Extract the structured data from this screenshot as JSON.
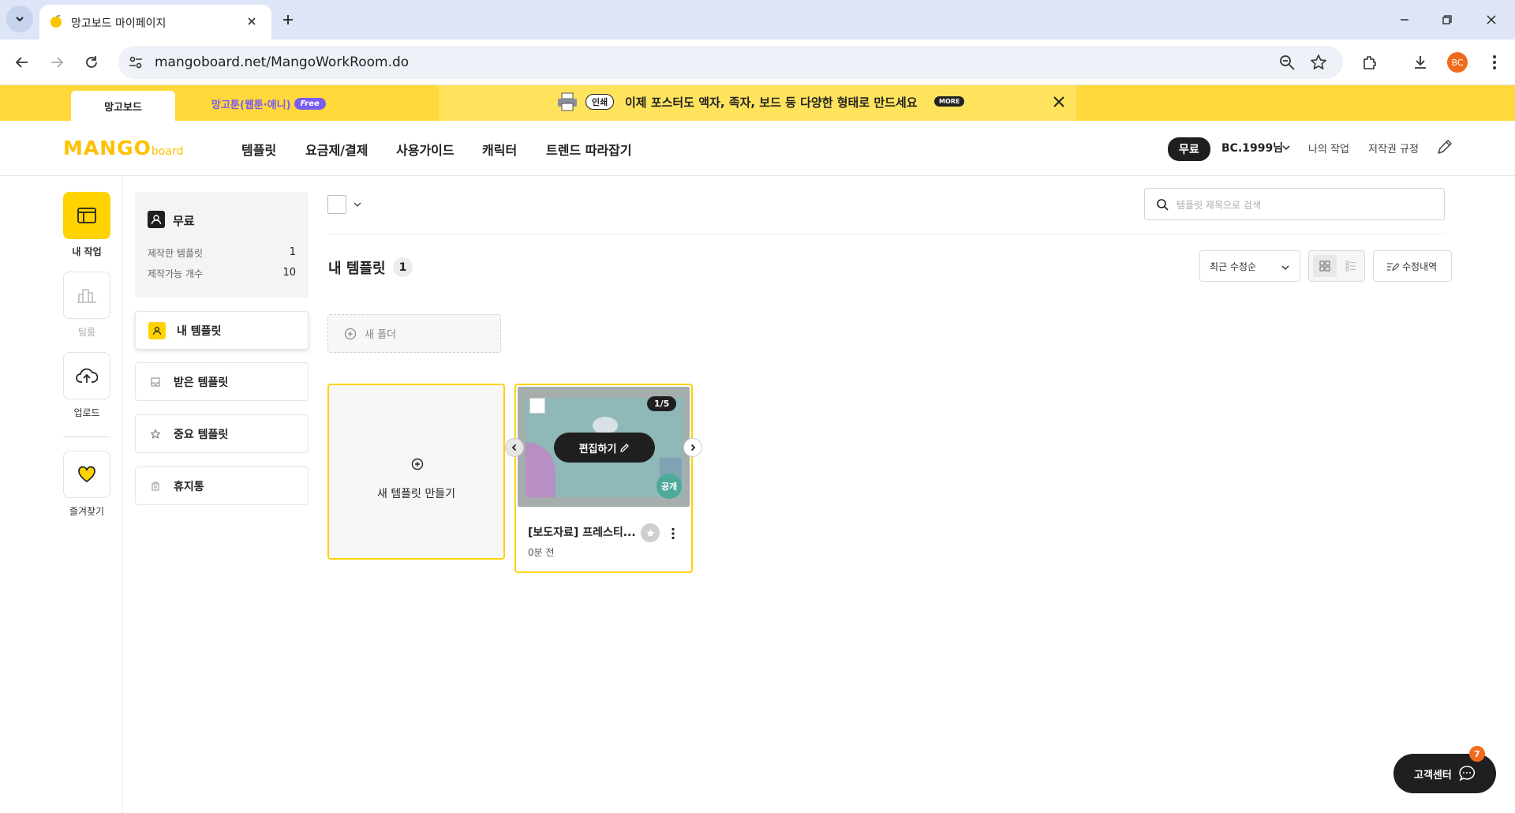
{
  "browser": {
    "tab_title": "망고보드 마이페이지",
    "url": "mangoboard.net/MangoWorkRoom.do",
    "profile_initials": "BC"
  },
  "banner": {
    "tab_active": "망고보드",
    "tab_other": "망고툰(웹툰·애니)",
    "free_badge": "Free",
    "print_badge": "인쇄",
    "message": "이제 포스터도 액자, 족자, 보드 등 다양한 형태로 만드세요",
    "more_badge": "MORE"
  },
  "header": {
    "logo_main": "MANGO",
    "logo_sub": "board",
    "nav": [
      "템플릿",
      "요금제/결제",
      "사용가이드",
      "캐릭터",
      "트렌드 따라잡기"
    ],
    "plan_badge": "무료",
    "user_name": "BC.1999님",
    "my_work": "나의 작업",
    "copyright": "저작권 규정"
  },
  "rail": {
    "my_work": "내 작업",
    "team": "팀룸",
    "upload": "업로드",
    "favorites": "즐겨찾기"
  },
  "plan_card": {
    "title": "무료",
    "made_label": "제작한 템플릿",
    "made_value": "1",
    "available_label": "제작가능 개수",
    "available_value": "10"
  },
  "menu": [
    "내 템플릿",
    "받은 템플릿",
    "중요 템플릿",
    "휴지통"
  ],
  "main": {
    "search_placeholder": "템플릿 제목으로 검색",
    "section_title": "내 템플릿",
    "section_count": "1",
    "sort_value": "최근 수정순",
    "history_button": "수정내역",
    "new_folder": "새 폴더",
    "new_template": "새 템플릿 만들기"
  },
  "card": {
    "page_badge": "1/5",
    "edit_button": "편집하기",
    "public_badge": "공개",
    "title": "[보도자료] 프레스티...",
    "time": "0분 전"
  },
  "support": {
    "label": "고객센터",
    "badge": "7"
  },
  "colors": {
    "brand_yellow": "#ffd200",
    "banner_bg": "#ffd83b",
    "free_purple": "#7b5cf0",
    "alert_orange": "#f26b1d",
    "dark": "#1f1f1f"
  }
}
